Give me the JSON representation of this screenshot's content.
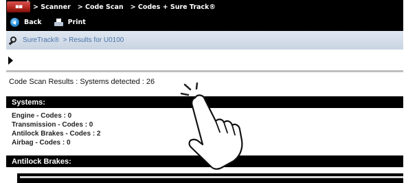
{
  "titlebar": {
    "logo_icon": "scanner-app-logo-icon",
    "breadcrumb": "> Scanner   > Code Scan   > Codes + Sure Track®"
  },
  "toolbar": {
    "back_label": "Back",
    "back_icon": "back-arrow-circle-icon",
    "print_label": "Print",
    "print_icon": "printer-icon"
  },
  "breadcrumb_bar": {
    "icon": "suretrack-magnifier-icon",
    "path": "SureTrack®  > Results for U0100"
  },
  "expand_icon": "triangle-right-icon",
  "results": {
    "title": "Code Scan Results : Systems detected : 26"
  },
  "systems": {
    "header": "Systems:",
    "items": [
      "Engine - Codes : 0",
      "Transmission - Codes : 0",
      "Antilock Brakes - Codes : 2",
      "Airbag - Codes : 0"
    ]
  },
  "antilock": {
    "header": "Antilock Brakes:"
  },
  "overlay": {
    "icon": "pointing-hand-tap-icon"
  },
  "colors": {
    "bar_black": "#000000",
    "crumb_bar_blue": "#d3dceb",
    "link_blue": "#4a73a8",
    "logo_red": "#c0312a"
  }
}
